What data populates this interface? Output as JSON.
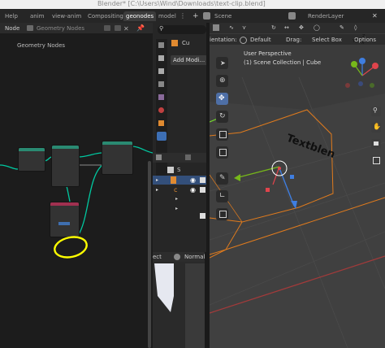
{
  "window": {
    "title": "Blender* [C:\\Users\\Wind\\Downloads\\text-clip.blend]"
  },
  "menu": {
    "help": "Help",
    "tabs": [
      "anim",
      "view-anim",
      "Compositing",
      "geonodes",
      "model"
    ],
    "scene": "Scene",
    "render_layer": "RenderLayer"
  },
  "node_editor": {
    "editor_label": "Node",
    "tree_name": "Geometry Nodes",
    "breadcrumb": "Geometry Nodes"
  },
  "properties": {
    "search_placeholder": "",
    "object_short": "Cu",
    "add_modifier": "Add Modi...",
    "outliner_row": "S"
  },
  "preview": {
    "label": "ect",
    "shading": "Normal"
  },
  "viewport": {
    "orientation_label": "ientation:",
    "orientation_value": "Default",
    "drag_label": "Drag:",
    "drag_value": "Select Box",
    "options": "Options",
    "view_name": "User Perspective",
    "collection": "(1) Scene Collection | Cube",
    "text_object": "Textblen",
    "gizmo_x": "X",
    "gizmo_y": "Y",
    "gizmo_z": "Z"
  },
  "colors": {
    "orange_outline": "#e07b1d",
    "teal_link": "#00c8a0",
    "gizmo_red": "#e0444c",
    "gizmo_green": "#77b81a",
    "gizmo_blue": "#3f7ee0",
    "highlight_yellow": "#ffff00"
  }
}
